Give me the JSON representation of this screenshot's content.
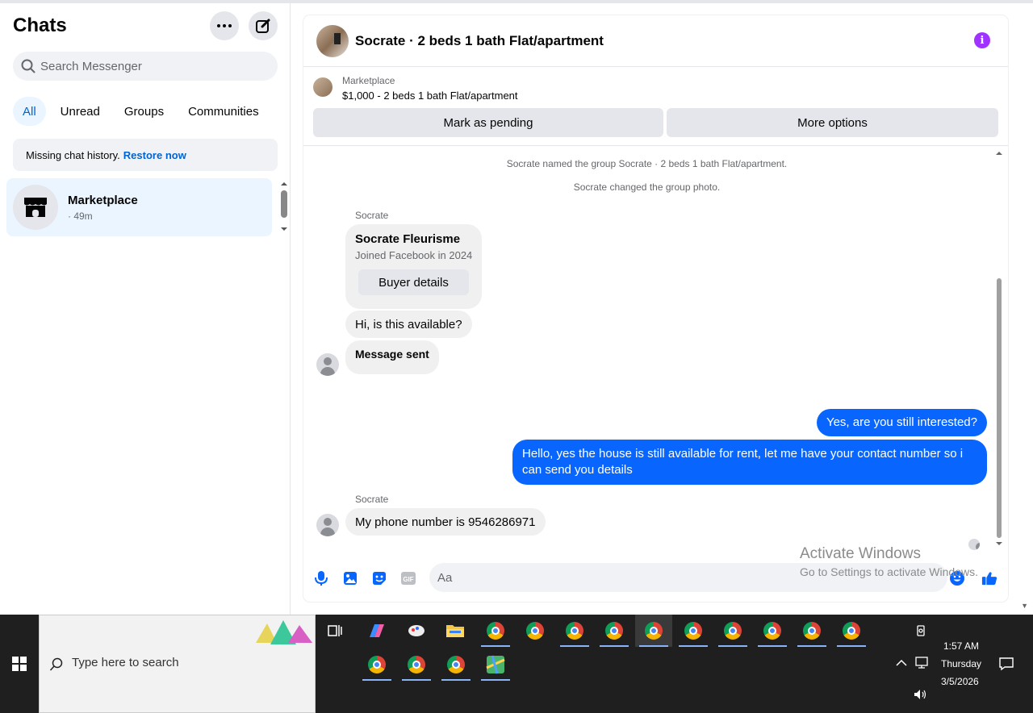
{
  "sidebar": {
    "title": "Chats",
    "search_placeholder": "Search Messenger",
    "filters": [
      "All",
      "Unread",
      "Groups",
      "Communities"
    ],
    "missing_history": "Missing chat history.",
    "restore_link": "Restore now",
    "chats": [
      {
        "name": "Marketplace",
        "time": "· 49m"
      }
    ]
  },
  "header": {
    "title": "Socrate · 2 beds 1 bath Flat/apartment"
  },
  "marketplace": {
    "label": "Marketplace",
    "listing": "$1,000 - 2 beds 1 bath Flat/apartment",
    "mark_pending": "Mark as pending",
    "more_options": "More options"
  },
  "conversation": {
    "system_messages": [
      "Socrate named the group Socrate · 2 beds 1 bath Flat/apartment.",
      "Socrate changed the group photo."
    ],
    "sender_name": "Socrate",
    "profile_card": {
      "name": "Socrate Fleurisme",
      "joined": "Joined Facebook in 2024",
      "button": "Buyer details"
    },
    "incoming": [
      "Hi, is this available?",
      "Message sent",
      "My phone number is 9546286971"
    ],
    "outgoing": [
      "Yes, are you still interested?",
      "Hello, yes the house is still available for rent, let me have your contact number so i can send you details"
    ]
  },
  "composer": {
    "placeholder": "Aa"
  },
  "watermark": {
    "line1": "Activate Windows",
    "line2": "Go to Settings to activate Windows."
  },
  "taskbar": {
    "search_placeholder": "Type here to search",
    "time": "1:57 AM",
    "day": "Thursday",
    "date": "3/5/2026"
  },
  "colors": {
    "accent": "#0866ff",
    "info": "#a033ff",
    "active_chip_bg": "#ebf5ff"
  }
}
